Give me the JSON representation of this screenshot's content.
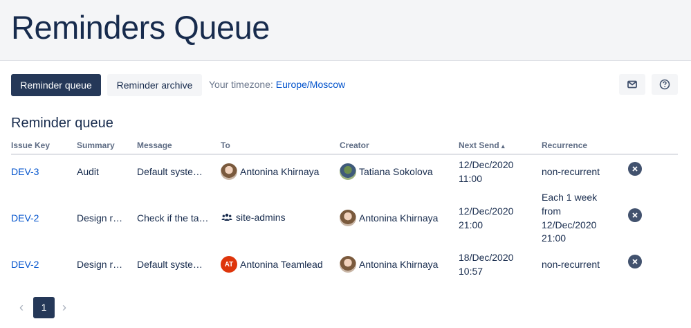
{
  "page": {
    "title": "Reminders Queue"
  },
  "toolbar": {
    "queue_label": "Reminder queue",
    "archive_label": "Reminder archive",
    "timezone_prefix": "Your timezone:",
    "timezone_value": "Europe/Moscow",
    "mail_icon": "mail-icon",
    "help_icon": "help-icon"
  },
  "section": {
    "title": "Reminder queue"
  },
  "table": {
    "headers": {
      "issue_key": "Issue Key",
      "summary": "Summary",
      "message": "Message",
      "to": "To",
      "creator": "Creator",
      "next_send": "Next Send",
      "recurrence": "Recurrence"
    },
    "sort_indicator": "▴",
    "rows": [
      {
        "issue_key": "DEV-3",
        "summary": "Audit",
        "message": "Default syste…",
        "to": "Antonina Khirnaya",
        "creator": "Tatiana Sokolova",
        "next_send_date": "12/Dec/2020",
        "next_send_time": "11:00",
        "recurrence": "non-recurrent"
      },
      {
        "issue_key": "DEV-2",
        "summary": "Design r…",
        "message": "Check if the ta…",
        "to": "site-admins",
        "creator": "Antonina Khirnaya",
        "next_send_date": "12/Dec/2020",
        "next_send_time": "21:00",
        "recurrence_lines": [
          "Each 1 week",
          "from",
          "12/Dec/2020",
          "21:00"
        ]
      },
      {
        "issue_key": "DEV-2",
        "summary": "Design r…",
        "message": "Default syste…",
        "to_initials": "AT",
        "to": "Antonina Teamlead",
        "creator": "Antonina Khirnaya",
        "next_send_date": "18/Dec/2020",
        "next_send_time": "10:57",
        "recurrence": "non-recurrent"
      }
    ]
  },
  "pagination": {
    "prev": "‹",
    "current": "1",
    "next": "›"
  },
  "colors": {
    "primary": "#253858",
    "link": "#0052cc",
    "header_bg": "#f4f5f7"
  }
}
